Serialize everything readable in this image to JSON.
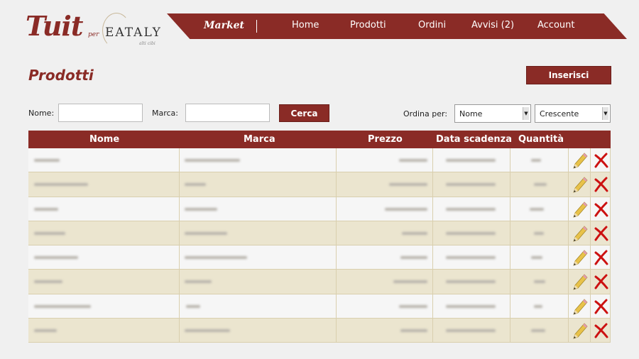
{
  "brand": {
    "name": "Tuit",
    "per": "per",
    "partner": "EATALY",
    "tagline": "alti cibi"
  },
  "nav": {
    "section": "Market",
    "items": [
      "Home",
      "Prodotti",
      "Ordini",
      "Avvisi (2)",
      "Account"
    ]
  },
  "page": {
    "title": "Prodotti",
    "insert_label": "Inserisci"
  },
  "filters": {
    "name_label": "Nome:",
    "name_value": "",
    "brand_label": "Marca:",
    "brand_value": "",
    "search_label": "Cerca",
    "sort_label": "Ordina per:",
    "sort_field": "Nome",
    "sort_order": "Crescente"
  },
  "table": {
    "headers": [
      "Nome",
      "Marca",
      "Prezzo",
      "Data scadenza",
      "Quantità"
    ],
    "row_count": 8
  },
  "icons": {
    "edit": "pencil-icon",
    "delete": "x-icon"
  },
  "colors": {
    "brand": "#8a2b26",
    "row_alt": "#ebe5cf",
    "row": "#f6f6f6",
    "delete": "#cc1111"
  }
}
